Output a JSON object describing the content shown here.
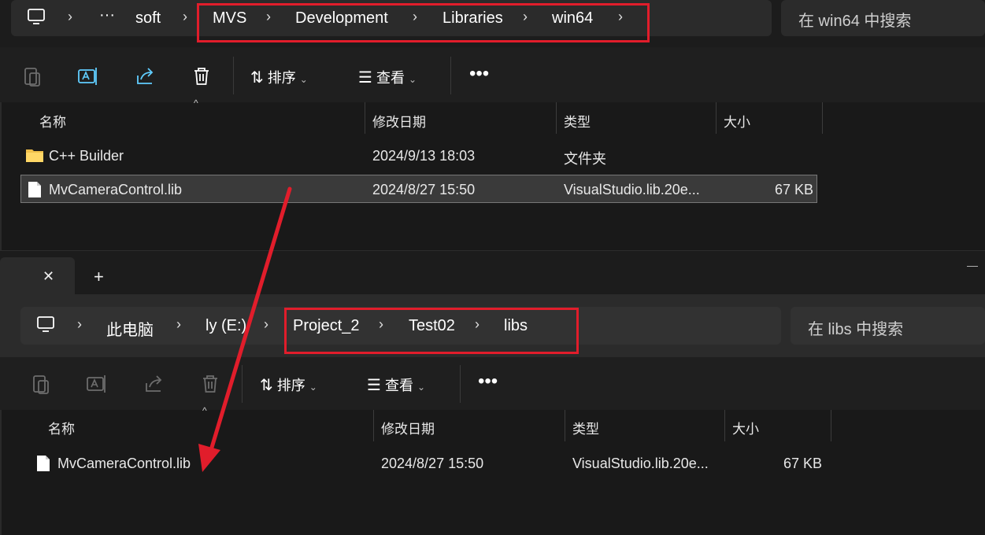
{
  "top_window": {
    "breadcrumb": [
      "soft",
      "MVS",
      "Development",
      "Libraries",
      "win64"
    ],
    "search_placeholder": "在 win64 中搜索",
    "toolbar": {
      "sort_label": "排序",
      "view_label": "查看"
    },
    "columns": [
      "名称",
      "修改日期",
      "类型",
      "大小"
    ],
    "rows": [
      {
        "name": "C++ Builder",
        "date": "2024/9/13 18:03",
        "type": "文件夹",
        "size": "",
        "icon": "folder-icon"
      },
      {
        "name": "MvCameraControl.lib",
        "date": "2024/8/27 15:50",
        "type": "VisualStudio.lib.20e...",
        "size": "67 KB",
        "icon": "file-icon",
        "selected": true
      }
    ]
  },
  "bottom_window": {
    "tab_close_glyph": "✕",
    "new_tab_glyph": "+",
    "breadcrumb": [
      "此电脑",
      "ly (E:)",
      "Project_2",
      "Test02",
      "libs"
    ],
    "search_placeholder": "在 libs 中搜索",
    "toolbar": {
      "sort_label": "排序",
      "view_label": "查看"
    },
    "columns": [
      "名称",
      "修改日期",
      "类型",
      "大小"
    ],
    "rows": [
      {
        "name": "MvCameraControl.lib",
        "date": "2024/8/27 15:50",
        "type": "VisualStudio.lib.20e...",
        "size": "67 KB",
        "icon": "file-icon"
      }
    ]
  },
  "colors": {
    "annotation_red": "#e11d2b",
    "background": "#1c1c1c",
    "panel": "#2b2b2b",
    "selection": "#3a3a3a"
  }
}
